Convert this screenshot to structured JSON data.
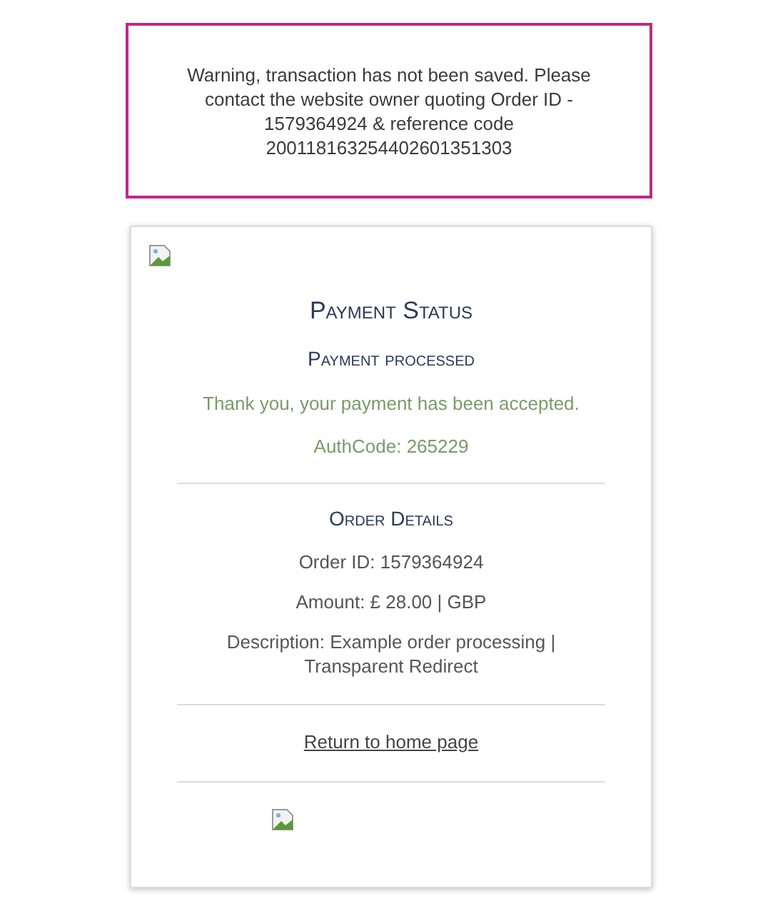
{
  "warning": {
    "text": "Warning, transaction has not been saved. Please contact the website owner quoting Order ID - 1579364924 & reference code 200118163254402601351303"
  },
  "payment": {
    "title": "Payment Status",
    "status": "Payment processed",
    "message": "Thank you, your payment has been accepted.",
    "auth_code": "AuthCode: 265229"
  },
  "order": {
    "title": "Order Details",
    "lines": [
      "Order ID: 1579364924",
      "Amount: £ 28.00 | GBP",
      "Description: Example order processing | Transparent Redirect"
    ]
  },
  "link": "Return to home page"
}
